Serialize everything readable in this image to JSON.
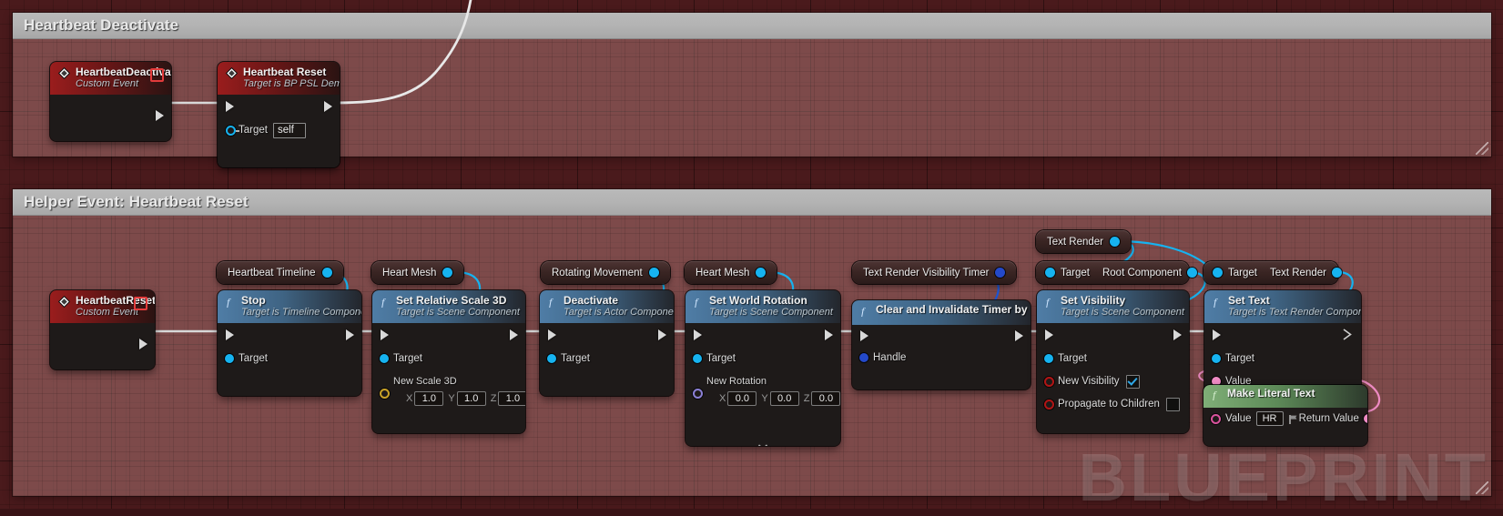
{
  "canvas": {
    "watermark": "BLUEPRINT",
    "colors": {
      "background": "#4a1a1c",
      "comment_fill": "#d7a09e",
      "comment_bar": "#b3b3b3",
      "event_header": "#9a1d1d",
      "function_header": "#4f7da6",
      "pure_function_header": "#7fae77",
      "exec_wire": "#d8d8d8",
      "object_wire": "#16b3f0",
      "text_wire": "#ef8bc4",
      "object_pin": "#16b3f0",
      "bool_pin": "#b11515",
      "struct_pin": "#c9a227",
      "rotator_pin": "#8a7fd4",
      "text_pin": "#ef8bc4"
    }
  },
  "comments": [
    {
      "id": "comment-deactivate",
      "title": "Heartbeat Deactivate"
    },
    {
      "id": "comment-reset",
      "title": "Helper Event: Heartbeat Reset"
    }
  ],
  "nodes": {
    "heartbeat_deactivate_event": {
      "title": "HeartbeatDeactivate",
      "subtitle": "Custom Event",
      "kind": "event"
    },
    "heartbeat_reset_call": {
      "title": "Heartbeat Reset",
      "subtitle": "Target is BP PSL Demo",
      "kind": "event",
      "pins": [
        {
          "label": "Target",
          "value": "self"
        }
      ]
    },
    "heartbeat_reset_event": {
      "title": "HeartbeatReset",
      "subtitle": "Custom Event",
      "kind": "event"
    },
    "stop": {
      "title": "Stop",
      "subtitle": "Target is Timeline Component",
      "kind": "function",
      "pins": [
        {
          "label": "Target"
        }
      ]
    },
    "set_relative_scale_3d": {
      "title": "Set Relative Scale 3D",
      "subtitle": "Target is Scene Component",
      "kind": "function",
      "pins": [
        {
          "label": "Target"
        }
      ],
      "vector": {
        "label": "New Scale 3D",
        "axes": [
          "X",
          "Y",
          "Z"
        ],
        "values": [
          "1.0",
          "1.0",
          "1.0"
        ]
      }
    },
    "deactivate": {
      "title": "Deactivate",
      "subtitle": "Target is Actor Component",
      "kind": "function",
      "pins": [
        {
          "label": "Target"
        }
      ]
    },
    "set_world_rotation": {
      "title": "Set World Rotation",
      "subtitle": "Target is Scene Component",
      "kind": "function",
      "pins": [
        {
          "label": "Target"
        }
      ],
      "vector": {
        "label": "New Rotation",
        "axes": [
          "X",
          "Y",
          "Z"
        ],
        "values": [
          "0.0",
          "0.0",
          "0.0"
        ]
      }
    },
    "clear_and_invalidate_timer": {
      "title": "Clear and Invalidate Timer by Handle",
      "subtitle": "",
      "kind": "function",
      "pins": [
        {
          "label": "Handle"
        }
      ]
    },
    "set_visibility": {
      "title": "Set Visibility",
      "subtitle": "Target is Scene Component",
      "kind": "function",
      "pins": [
        {
          "label": "Target"
        },
        {
          "label": "New Visibility",
          "checked": true
        },
        {
          "label": "Propagate to Children",
          "checked": false
        }
      ]
    },
    "set_text": {
      "title": "Set Text",
      "subtitle": "Target is Text Render Component",
      "kind": "function",
      "pins": [
        {
          "label": "Target"
        },
        {
          "label": "Value"
        }
      ]
    },
    "make_literal_text": {
      "title": "Make Literal Text",
      "subtitle": "",
      "kind": "pure",
      "input_label": "Value",
      "input_value": "HR",
      "output_label": "Return Value"
    }
  },
  "variables": {
    "heartbeat_timeline": {
      "label": "Heartbeat Timeline"
    },
    "heart_mesh_1": {
      "label": "Heart Mesh"
    },
    "rotating_movement": {
      "label": "Rotating Movement"
    },
    "heart_mesh_2": {
      "label": "Heart Mesh"
    },
    "text_render_visibility_timer": {
      "label": "Text Render Visibility Timer"
    },
    "text_render_1": {
      "label": "Text Render"
    },
    "get_root_component": {
      "in_label": "Target",
      "out_label": "Root Component"
    },
    "get_text_render": {
      "in_label": "Target",
      "out_label": "Text Render"
    }
  }
}
